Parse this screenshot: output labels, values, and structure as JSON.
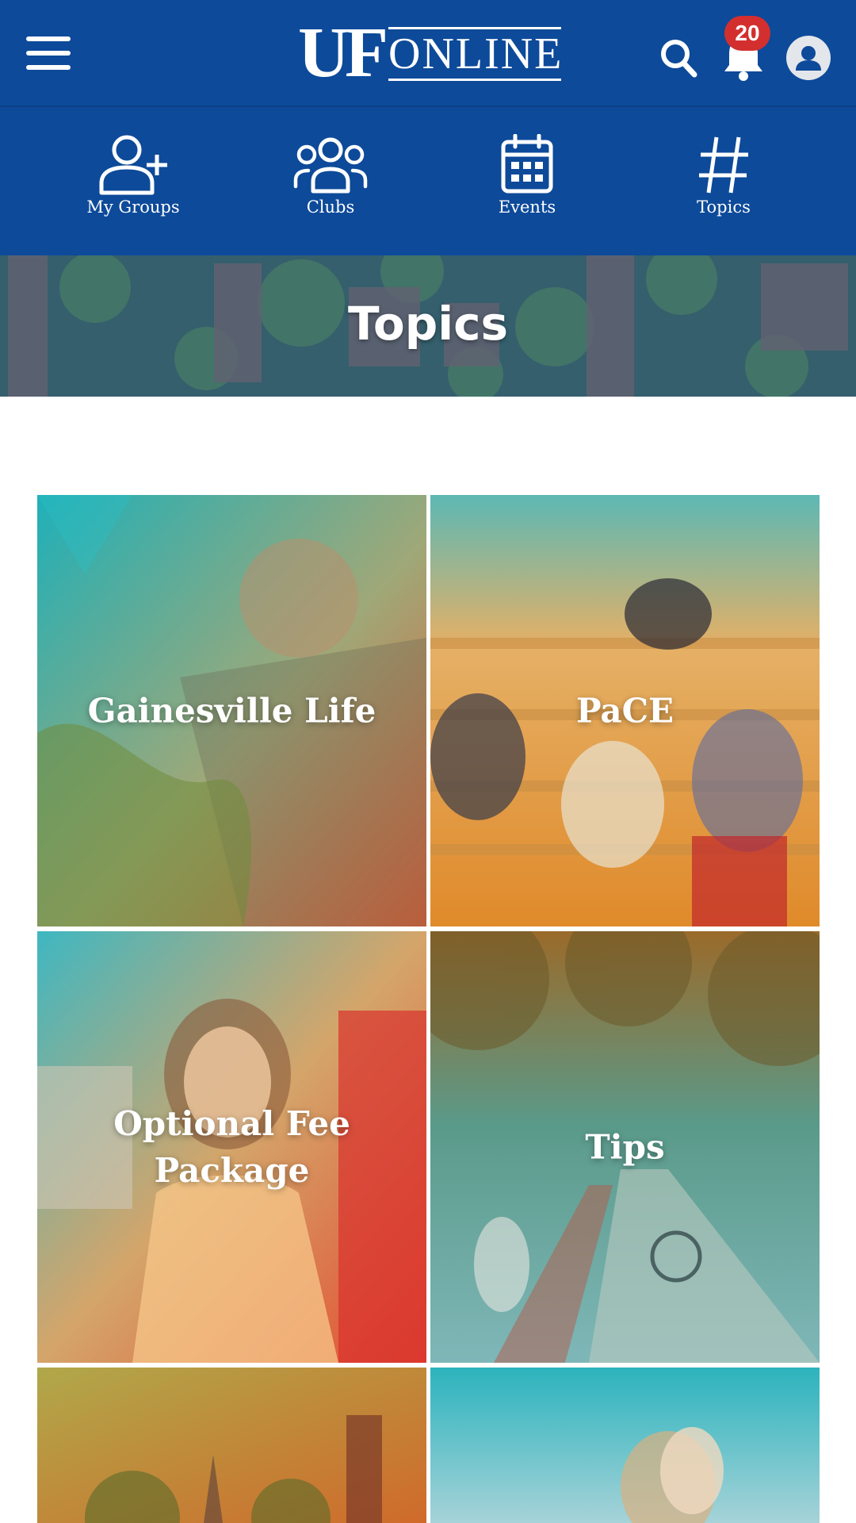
{
  "header": {
    "logo_left": "UF",
    "logo_right": "ONLINE",
    "notification_count": "20",
    "menu_icon": "hamburger-menu-icon",
    "search_icon": "search-icon",
    "bell_icon": "bell-icon",
    "avatar_icon": "user-avatar-icon"
  },
  "subnav": {
    "items": [
      {
        "label": "My Groups",
        "icon": "add-user-icon"
      },
      {
        "label": "Clubs",
        "icon": "group-icon"
      },
      {
        "label": "Events",
        "icon": "calendar-icon"
      },
      {
        "label": "Topics",
        "icon": "hashtag-icon"
      }
    ]
  },
  "banner": {
    "title": "Topics"
  },
  "topics": [
    {
      "label": "Gainesville Life"
    },
    {
      "label": "PaCE"
    },
    {
      "label": "Optional Fee Package"
    },
    {
      "label": "Tips"
    },
    {
      "label": ""
    },
    {
      "label": ""
    }
  ],
  "colors": {
    "brand_blue": "#0d4a9a",
    "badge_red": "#d32f2f",
    "teal_overlay": "#1fb0b8",
    "orange_overlay": "#f08a24"
  }
}
